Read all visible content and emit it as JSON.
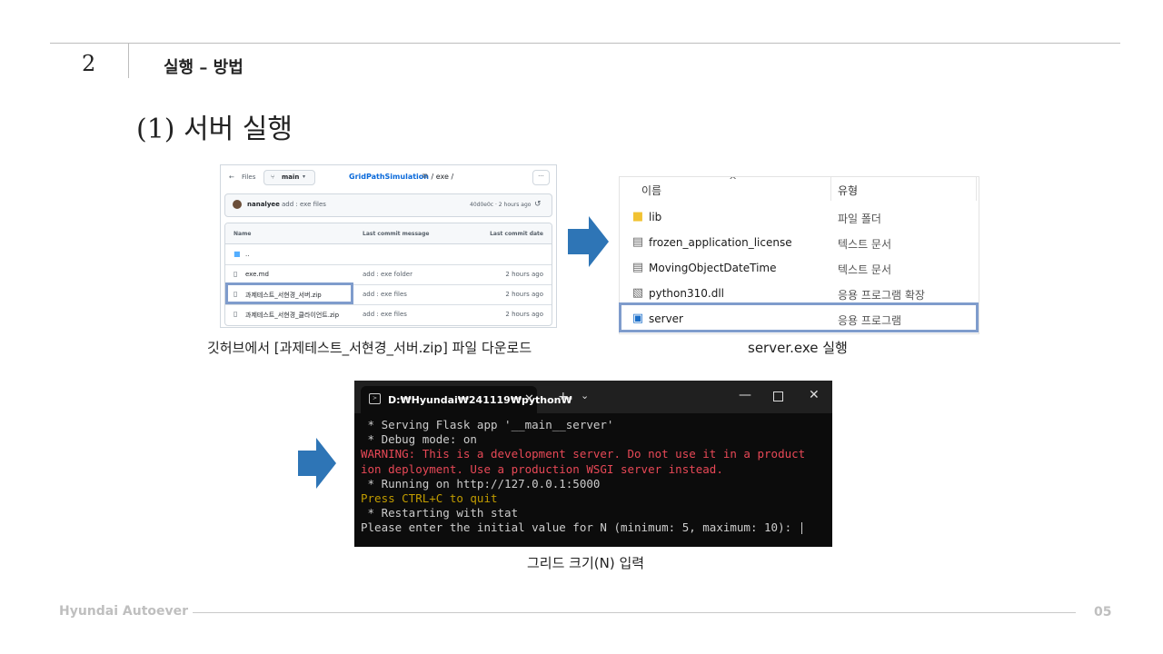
{
  "header": {
    "section_number": "2",
    "section_title": "실행 – 방법",
    "subtitle": "(1) 서버 실행"
  },
  "github": {
    "back_label": "←",
    "files_label": "Files",
    "branch": "main",
    "repo": "GridPathSimulation",
    "path_rest": " / exe /",
    "more_label": "···",
    "commit": {
      "author": "nanalyee",
      "message": "add : exe files",
      "hash_time": "40d0e0c · 2 hours ago"
    },
    "columns": [
      "Name",
      "Last commit message",
      "Last commit date"
    ],
    "rows": [
      {
        "name": "..",
        "message": "",
        "date": "",
        "icon": "folder-icon"
      },
      {
        "name": "exe.md",
        "message": "add : exe folder",
        "date": "2 hours ago",
        "icon": "file-icon"
      },
      {
        "name": "과제테스트_서현경_서버.zip",
        "message": "add : exe files",
        "date": "2 hours ago",
        "icon": "file-icon"
      },
      {
        "name": "과제테스트_서현경_클라이언트.zip",
        "message": "add : exe files",
        "date": "2 hours ago",
        "icon": "file-icon"
      }
    ],
    "caption": "깃허브에서 [과제테스트_서현경_서버.zip] 파일 다운로드"
  },
  "explorer": {
    "col_name": "이름",
    "col_type": "유형",
    "sort_glyph": "^",
    "rows": [
      {
        "name": "lib",
        "type": "파일 폴더",
        "icon": "folder-icon"
      },
      {
        "name": "frozen_application_license",
        "type": "텍스트 문서",
        "icon": "text-document-icon"
      },
      {
        "name": "MovingObjectDateTime",
        "type": "텍스트 문서",
        "icon": "text-document-icon"
      },
      {
        "name": "python310.dll",
        "type": "응용 프로그램 확장",
        "icon": "dll-icon"
      },
      {
        "name": "server",
        "type": "응용 프로그램",
        "icon": "application-icon"
      }
    ],
    "caption": "server.exe 실행"
  },
  "terminal": {
    "tab_title": "D:₩Hyundai₩241119₩python₩",
    "lines": [
      {
        "text": " * Serving Flask app '__main__server'",
        "color": "normal"
      },
      {
        "text": " * Debug mode: on",
        "color": "normal"
      },
      {
        "text": "WARNING: This is a development server. Do not use it in a product",
        "color": "red"
      },
      {
        "text": "ion deployment. Use a production WSGI server instead.",
        "color": "red"
      },
      {
        "text": " * Running on http://127.0.0.1:5000",
        "color": "normal"
      },
      {
        "text": "Press CTRL+C to quit",
        "color": "yellow"
      },
      {
        "text": " * Restarting with stat",
        "color": "normal"
      },
      {
        "text": "Please enter the initial value for N (minimum: 5, maximum: 10): ",
        "color": "normal"
      }
    ],
    "caption": "그리드 크기(N) 입력"
  },
  "footer": {
    "brand": "Hyundai Autoever",
    "page": "05"
  },
  "colors": {
    "arrow": "#2e75b6",
    "highlight_box": "#7f9ccc",
    "terminal_red": "#e74856",
    "terminal_yellow": "#c19c00",
    "link_blue": "#0969da"
  }
}
